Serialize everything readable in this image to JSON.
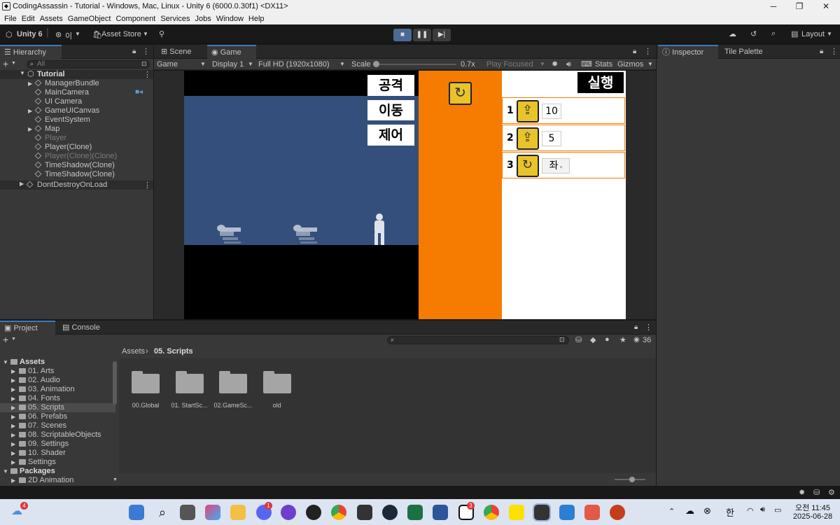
{
  "window": {
    "title": "CodingAssassin - Tutorial - Windows, Mac, Linux - Unity 6 (6000.0.30f1) <DX11>",
    "minimize": "─",
    "restore": "❐",
    "close": "✕"
  },
  "menu": [
    "File",
    "Edit",
    "Assets",
    "GameObject",
    "Component",
    "Services",
    "Jobs",
    "Window",
    "Help"
  ],
  "toolbar": {
    "unity_version": "Unity 6",
    "account": "이",
    "asset_store": "Asset Store",
    "layout": "Layout"
  },
  "hierarchy": {
    "tab": "Hierarchy",
    "search_placeholder": "All",
    "scene": "Tutorial",
    "items": [
      {
        "name": "ManagerBundle",
        "dim": false,
        "arrow": true
      },
      {
        "name": "MainCamera",
        "dim": false,
        "arrow": false
      },
      {
        "name": "UI Camera",
        "dim": false,
        "arrow": false
      },
      {
        "name": "GameUICanvas",
        "dim": false,
        "arrow": true
      },
      {
        "name": "EventSystem",
        "dim": false,
        "arrow": false
      },
      {
        "name": "Map",
        "dim": false,
        "arrow": true
      },
      {
        "name": "Player",
        "dim": true,
        "arrow": false
      },
      {
        "name": "Player(Clone)",
        "dim": false,
        "arrow": false
      },
      {
        "name": "Player(Clone)(Clone)",
        "dim": true,
        "arrow": false
      },
      {
        "name": "TimeShadow(Clone)",
        "dim": false,
        "arrow": false
      },
      {
        "name": "TimeShadow(Clone)",
        "dim": false,
        "arrow": false
      }
    ],
    "dontdestroy": "DontDestroyOnLoad"
  },
  "tabs": {
    "scene": "Scene",
    "game": "Game",
    "inspector": "Inspector",
    "tile_palette": "Tile Palette",
    "project": "Project",
    "console": "Console"
  },
  "gamebar": {
    "mode": "Game",
    "display": "Display 1",
    "resolution": "Full HD (1920x1080)",
    "scale_label": "Scale",
    "scale_value": "0.7x",
    "play_focused": "Play Focused",
    "stats": "Stats",
    "gizmos": "Gizmos"
  },
  "game": {
    "buttons": [
      "공격",
      "이동",
      "제어"
    ],
    "run": "실행",
    "slots": [
      {
        "num": "1",
        "value": "10"
      },
      {
        "num": "2",
        "value": "5"
      },
      {
        "num": "3",
        "value": "좌"
      }
    ],
    "colors": {
      "sky": "#344f7b",
      "orange": "#f57c00",
      "panel": "#ffffff",
      "ground": "#000000"
    }
  },
  "project": {
    "breadcrumb_root": "Assets",
    "breadcrumb_sep": "›",
    "breadcrumb_current": "05. Scripts",
    "count": "36",
    "tree": [
      {
        "label": "Assets",
        "level": 0,
        "bold": true
      },
      {
        "label": "01. Arts",
        "level": 1
      },
      {
        "label": "02. Audio",
        "level": 1
      },
      {
        "label": "03. Animation",
        "level": 1
      },
      {
        "label": "04. Fonts",
        "level": 1
      },
      {
        "label": "05. Scripts",
        "level": 1,
        "selected": true
      },
      {
        "label": "06. Prefabs",
        "level": 1
      },
      {
        "label": "07. Scenes",
        "level": 1
      },
      {
        "label": "08. ScriptableObjects",
        "level": 1
      },
      {
        "label": "09. Settings",
        "level": 1
      },
      {
        "label": "10. Shader",
        "level": 1
      },
      {
        "label": "Settings",
        "level": 1
      },
      {
        "label": "Packages",
        "level": 0,
        "bold": true
      },
      {
        "label": "2D Animation",
        "level": 1
      }
    ],
    "folders": [
      "00.Global",
      "01. StartSc...",
      "02.GameSc...",
      "old"
    ]
  },
  "taskbar": {
    "time": "오전 11:45",
    "date": "2025-06-28",
    "ime": "한",
    "weather_badge": "4",
    "discord_badge": "1",
    "notion_badge": "3"
  }
}
